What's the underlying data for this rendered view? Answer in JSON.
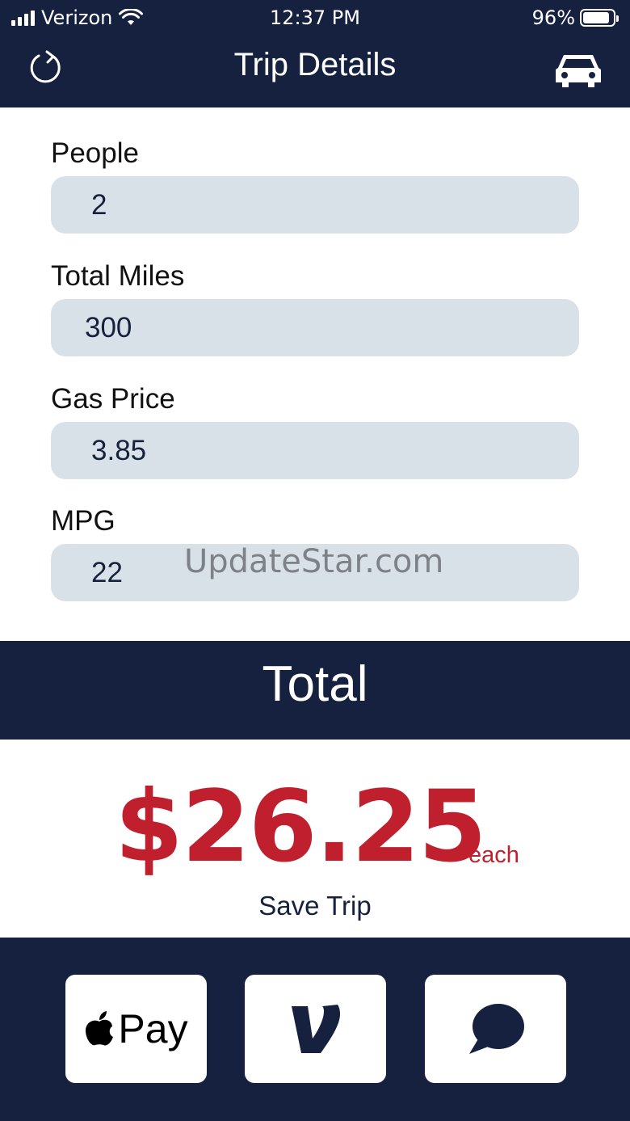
{
  "status_bar": {
    "carrier": "Verizon",
    "time": "12:37 PM",
    "battery": "96%"
  },
  "nav": {
    "title": "Trip Details",
    "left_icon": "refresh-icon",
    "right_icon": "car-icon"
  },
  "fields": [
    {
      "label": "People",
      "value": "2"
    },
    {
      "label": "Total Miles",
      "value": "300"
    },
    {
      "label": "Gas Price",
      "value": "3.85"
    },
    {
      "label": "MPG",
      "value": "22"
    }
  ],
  "watermark": "UpdateStar.com",
  "total": {
    "heading": "Total",
    "amount": "$26.25",
    "suffix": "each",
    "save_label": "Save Trip"
  },
  "payment": {
    "apple_pay_label": "Pay",
    "venmo_icon": "venmo-icon",
    "message_icon": "message-bubble-icon"
  },
  "colors": {
    "navy": "#16213f",
    "accent_red": "#c0202e",
    "input_bg": "#d9e1e8"
  }
}
